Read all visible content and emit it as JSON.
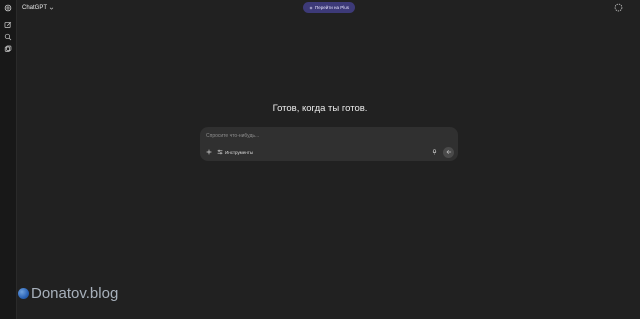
{
  "header": {
    "model_name": "ChatGPT",
    "upgrade_label": "Перейти на Plus"
  },
  "main": {
    "heading": "Готов, когда ты готов."
  },
  "composer": {
    "placeholder": "Спросите что-нибудь...",
    "tools_label": "Инструменты"
  },
  "watermark": {
    "text": "Donatov.blog"
  },
  "icons": {
    "sidebar": [
      "openai-logo-icon",
      "new-chat-icon",
      "search-icon",
      "library-icon"
    ],
    "header": [
      "chevron-down-icon",
      "sparkle-icon",
      "temporary-chat-icon"
    ],
    "composer": [
      "plus-icon",
      "tools-icon",
      "microphone-icon",
      "send-arrow-icon"
    ]
  },
  "colors": {
    "background": "#212121",
    "sidebar": "#181818",
    "composer": "#303030",
    "upgrade_button": "#3d3a78"
  }
}
